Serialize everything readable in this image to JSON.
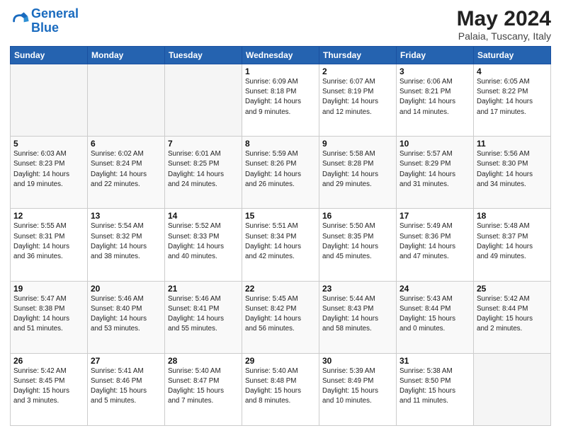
{
  "header": {
    "logo_general": "General",
    "logo_blue": "Blue",
    "month_title": "May 2024",
    "location": "Palaia, Tuscany, Italy"
  },
  "weekdays": [
    "Sunday",
    "Monday",
    "Tuesday",
    "Wednesday",
    "Thursday",
    "Friday",
    "Saturday"
  ],
  "weeks": [
    [
      {
        "day": "",
        "info": ""
      },
      {
        "day": "",
        "info": ""
      },
      {
        "day": "",
        "info": ""
      },
      {
        "day": "1",
        "info": "Sunrise: 6:09 AM\nSunset: 8:18 PM\nDaylight: 14 hours\nand 9 minutes."
      },
      {
        "day": "2",
        "info": "Sunrise: 6:07 AM\nSunset: 8:19 PM\nDaylight: 14 hours\nand 12 minutes."
      },
      {
        "day": "3",
        "info": "Sunrise: 6:06 AM\nSunset: 8:21 PM\nDaylight: 14 hours\nand 14 minutes."
      },
      {
        "day": "4",
        "info": "Sunrise: 6:05 AM\nSunset: 8:22 PM\nDaylight: 14 hours\nand 17 minutes."
      }
    ],
    [
      {
        "day": "5",
        "info": "Sunrise: 6:03 AM\nSunset: 8:23 PM\nDaylight: 14 hours\nand 19 minutes."
      },
      {
        "day": "6",
        "info": "Sunrise: 6:02 AM\nSunset: 8:24 PM\nDaylight: 14 hours\nand 22 minutes."
      },
      {
        "day": "7",
        "info": "Sunrise: 6:01 AM\nSunset: 8:25 PM\nDaylight: 14 hours\nand 24 minutes."
      },
      {
        "day": "8",
        "info": "Sunrise: 5:59 AM\nSunset: 8:26 PM\nDaylight: 14 hours\nand 26 minutes."
      },
      {
        "day": "9",
        "info": "Sunrise: 5:58 AM\nSunset: 8:28 PM\nDaylight: 14 hours\nand 29 minutes."
      },
      {
        "day": "10",
        "info": "Sunrise: 5:57 AM\nSunset: 8:29 PM\nDaylight: 14 hours\nand 31 minutes."
      },
      {
        "day": "11",
        "info": "Sunrise: 5:56 AM\nSunset: 8:30 PM\nDaylight: 14 hours\nand 34 minutes."
      }
    ],
    [
      {
        "day": "12",
        "info": "Sunrise: 5:55 AM\nSunset: 8:31 PM\nDaylight: 14 hours\nand 36 minutes."
      },
      {
        "day": "13",
        "info": "Sunrise: 5:54 AM\nSunset: 8:32 PM\nDaylight: 14 hours\nand 38 minutes."
      },
      {
        "day": "14",
        "info": "Sunrise: 5:52 AM\nSunset: 8:33 PM\nDaylight: 14 hours\nand 40 minutes."
      },
      {
        "day": "15",
        "info": "Sunrise: 5:51 AM\nSunset: 8:34 PM\nDaylight: 14 hours\nand 42 minutes."
      },
      {
        "day": "16",
        "info": "Sunrise: 5:50 AM\nSunset: 8:35 PM\nDaylight: 14 hours\nand 45 minutes."
      },
      {
        "day": "17",
        "info": "Sunrise: 5:49 AM\nSunset: 8:36 PM\nDaylight: 14 hours\nand 47 minutes."
      },
      {
        "day": "18",
        "info": "Sunrise: 5:48 AM\nSunset: 8:37 PM\nDaylight: 14 hours\nand 49 minutes."
      }
    ],
    [
      {
        "day": "19",
        "info": "Sunrise: 5:47 AM\nSunset: 8:38 PM\nDaylight: 14 hours\nand 51 minutes."
      },
      {
        "day": "20",
        "info": "Sunrise: 5:46 AM\nSunset: 8:40 PM\nDaylight: 14 hours\nand 53 minutes."
      },
      {
        "day": "21",
        "info": "Sunrise: 5:46 AM\nSunset: 8:41 PM\nDaylight: 14 hours\nand 55 minutes."
      },
      {
        "day": "22",
        "info": "Sunrise: 5:45 AM\nSunset: 8:42 PM\nDaylight: 14 hours\nand 56 minutes."
      },
      {
        "day": "23",
        "info": "Sunrise: 5:44 AM\nSunset: 8:43 PM\nDaylight: 14 hours\nand 58 minutes."
      },
      {
        "day": "24",
        "info": "Sunrise: 5:43 AM\nSunset: 8:44 PM\nDaylight: 15 hours\nand 0 minutes."
      },
      {
        "day": "25",
        "info": "Sunrise: 5:42 AM\nSunset: 8:44 PM\nDaylight: 15 hours\nand 2 minutes."
      }
    ],
    [
      {
        "day": "26",
        "info": "Sunrise: 5:42 AM\nSunset: 8:45 PM\nDaylight: 15 hours\nand 3 minutes."
      },
      {
        "day": "27",
        "info": "Sunrise: 5:41 AM\nSunset: 8:46 PM\nDaylight: 15 hours\nand 5 minutes."
      },
      {
        "day": "28",
        "info": "Sunrise: 5:40 AM\nSunset: 8:47 PM\nDaylight: 15 hours\nand 7 minutes."
      },
      {
        "day": "29",
        "info": "Sunrise: 5:40 AM\nSunset: 8:48 PM\nDaylight: 15 hours\nand 8 minutes."
      },
      {
        "day": "30",
        "info": "Sunrise: 5:39 AM\nSunset: 8:49 PM\nDaylight: 15 hours\nand 10 minutes."
      },
      {
        "day": "31",
        "info": "Sunrise: 5:38 AM\nSunset: 8:50 PM\nDaylight: 15 hours\nand 11 minutes."
      },
      {
        "day": "",
        "info": ""
      }
    ]
  ]
}
